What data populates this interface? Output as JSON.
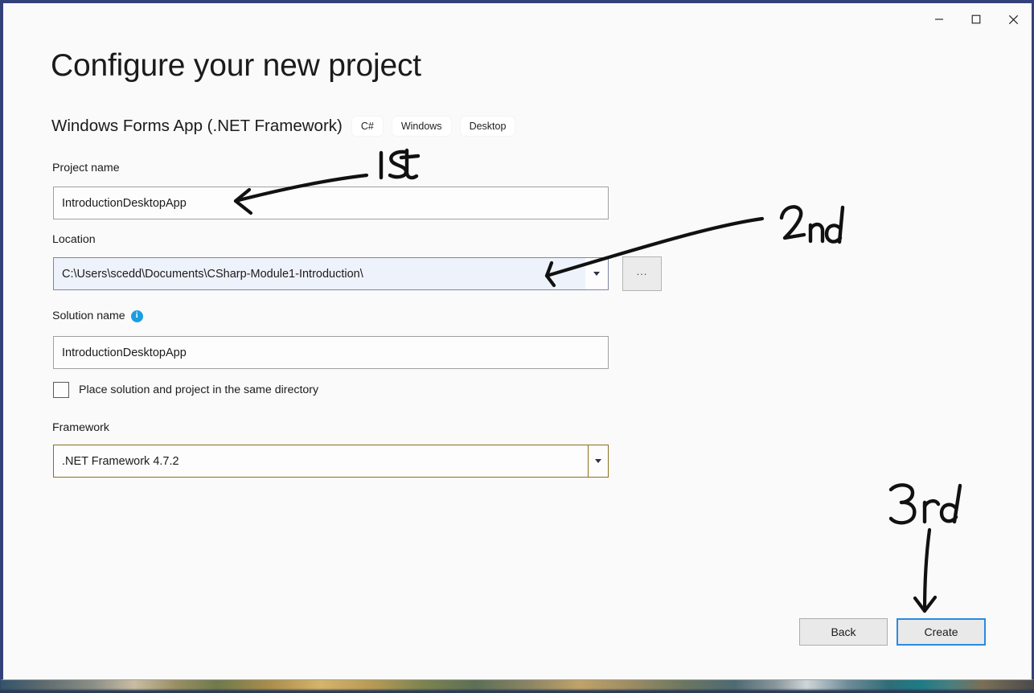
{
  "window": {
    "controls": [
      {
        "name": "minimize",
        "glyph": "minimize-icon",
        "label": "Minimize"
      },
      {
        "name": "maximize",
        "glyph": "maximize-icon",
        "label": "Maximize"
      },
      {
        "name": "close",
        "glyph": "close-icon",
        "label": "Close"
      }
    ]
  },
  "page": {
    "title": "Configure your new project",
    "template_name": "Windows Forms App (.NET Framework)",
    "tags": [
      "C#",
      "Windows",
      "Desktop"
    ]
  },
  "fields": {
    "project_name": {
      "label": "Project name",
      "value": "IntroductionDesktopApp"
    },
    "location": {
      "label": "Location",
      "value": "C:\\Users\\scedd\\Documents\\CSharp-Module1-Introduction\\",
      "browse_label": "...",
      "dropdown_icon": "chevron-down-icon"
    },
    "solution_name": {
      "label": "Solution name",
      "value": "IntroductionDesktopApp",
      "info_icon": "info-icon",
      "info_glyph": "i"
    },
    "same_directory": {
      "label": "Place solution and project in the same directory",
      "checked": false
    },
    "framework": {
      "label": "Framework",
      "value": ".NET Framework 4.7.2",
      "dropdown_icon": "chevron-down-icon"
    }
  },
  "footer": {
    "back_label": "Back",
    "create_label": "Create"
  },
  "annotations": [
    {
      "text": "1st",
      "target": "project-name-input"
    },
    {
      "text": "2nd",
      "target": "location-combo"
    },
    {
      "text": "3rd",
      "target": "create-button"
    }
  ],
  "colors": {
    "window_frame": "#33417a",
    "page_background": "#fafafa",
    "focus_blue": "#2a8ae0",
    "framework_border": "#8d6e1e",
    "location_fill": "#eef2fb",
    "info_blue": "#1a9ee0",
    "ink": "#111111"
  }
}
